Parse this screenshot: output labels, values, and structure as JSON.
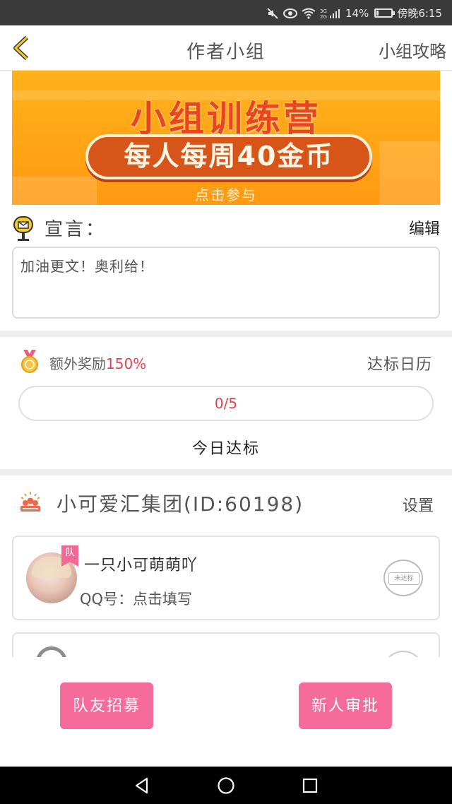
{
  "status_bar": {
    "battery": "14%",
    "battery_level": 0.14,
    "time": "傍晚6:15",
    "icons": [
      "mute-icon",
      "eye-icon",
      "wifi-icon",
      "signal-icon",
      "battery-icon"
    ]
  },
  "nav": {
    "title": "作者小组",
    "right_link": "小组攻略",
    "back_icon": "back-chevron-icon"
  },
  "banner": {
    "title": "小组训练营",
    "highlight": "每人每周40金币",
    "cta": "点击参与"
  },
  "manifesto": {
    "label": "宣言：",
    "edit": "编辑",
    "text": "加油更文！奥利给！"
  },
  "reward": {
    "label": "额外奖励",
    "percent": "150%",
    "calendar_link": "达标日历",
    "progress_text": "0/5",
    "progress_done": 0,
    "progress_total": 5,
    "today": "今日达标"
  },
  "group": {
    "name": "小可爱汇集团(ID:60198)",
    "settings": "设置"
  },
  "members": [
    {
      "badge": "队",
      "name": "一只小可萌萌吖",
      "qq": "QQ号：点击填写",
      "status": "未达标"
    }
  ],
  "actions": {
    "recruit": "队友招募",
    "approve": "新人审批"
  },
  "colors": {
    "accent_pink": "#f56b9a",
    "reward_red": "#e8424f",
    "banner_orange": "#ff9a12"
  }
}
